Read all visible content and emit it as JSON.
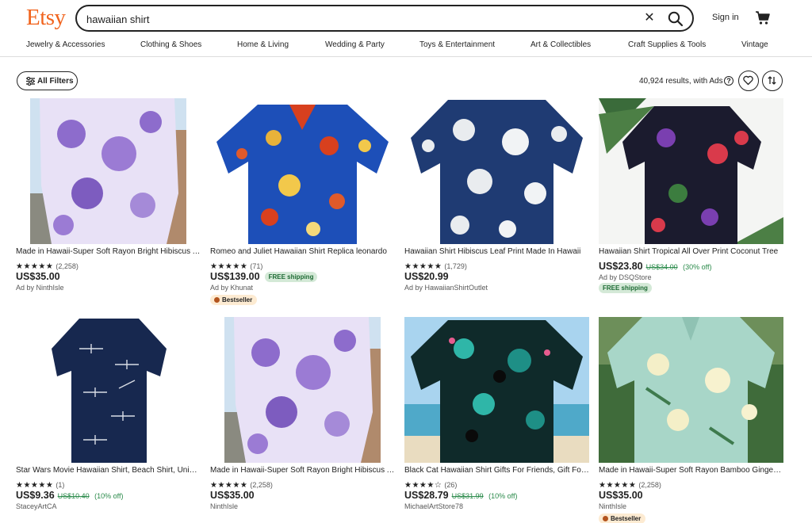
{
  "header": {
    "logo": "Etsy",
    "search_value": "hawaiian shirt",
    "signin": "Sign in"
  },
  "categories": [
    "Jewelry & Accessories",
    "Clothing & Shoes",
    "Home & Living",
    "Wedding & Party",
    "Toys & Entertainment",
    "Art & Collectibles",
    "Craft Supplies & Tools",
    "Vintage"
  ],
  "toolbar": {
    "filters_label": "All Filters",
    "results_text": "40,924 results, with Ads"
  },
  "listings": [
    {
      "title": "Made in Hawaii-Super Soft Rayon Bright Hibiscus Aloha Shirt",
      "stars": "★★★★★",
      "reviews": "(2,258)",
      "price": "US$35.00",
      "original": "",
      "discount": "",
      "shop": "Ad by NinthIsle",
      "free_shipping": "",
      "badge": ""
    },
    {
      "title": "Romeo and Juliet Hawaiian Shirt Replica leonardo",
      "stars": "★★★★★",
      "reviews": "(71)",
      "price": "US$139.00",
      "original": "",
      "discount": "",
      "shop": "Ad by Khunat",
      "free_shipping": "FREE shipping",
      "badge": "Bestseller"
    },
    {
      "title": "Hawaiian Shirt Hibiscus Leaf Print Made In Hawaii",
      "stars": "★★★★★",
      "reviews": "(1,729)",
      "price": "US$20.99",
      "original": "",
      "discount": "",
      "shop": "Ad by HawaiianShirtOutlet",
      "free_shipping": "",
      "badge": ""
    },
    {
      "title": "Hawaiian Shirt Tropical All Over Print Coconut Tree",
      "stars": "",
      "reviews": "",
      "price": "US$23.80",
      "original": "US$34.00",
      "discount": "(30% off)",
      "shop": "Ad by DSQStore",
      "free_shipping": "FREE shipping",
      "badge": ""
    },
    {
      "title": "Star Wars Movie Hawaiian Shirt, Beach Shirt, Unisex",
      "stars": "★★★★★",
      "reviews": "(1)",
      "price": "US$9.36",
      "original": "US$10.40",
      "discount": "(10% off)",
      "shop": "StaceyArtCA",
      "free_shipping": "",
      "badge": ""
    },
    {
      "title": "Made in Hawaii-Super Soft Rayon Bright Hibiscus Aloha Shirt",
      "stars": "★★★★★",
      "reviews": "(2,258)",
      "price": "US$35.00",
      "original": "",
      "discount": "",
      "shop": "NinthIsle",
      "free_shipping": "",
      "badge": ""
    },
    {
      "title": "Black Cat Hawaiian Shirt Gifts For Friends, Gift For Cat Lover",
      "stars": "★★★★☆",
      "reviews": "(26)",
      "price": "US$28.79",
      "original": "US$31.99",
      "discount": "(10% off)",
      "shop": "MichaelArtStore78",
      "free_shipping": "",
      "badge": ""
    },
    {
      "title": "Made in Hawaii-Super Soft Rayon Bamboo Ginger Aloha Shirt",
      "stars": "★★★★★",
      "reviews": "(2,258)",
      "price": "US$35.00",
      "original": "",
      "discount": "",
      "shop": "NinthIsle",
      "free_shipping": "",
      "badge": "Bestseller"
    }
  ],
  "icons": {
    "search": "search-icon",
    "clear": "close-icon",
    "cart": "cart-icon",
    "filters": "sliders-icon",
    "help": "question-circle-icon",
    "favorite": "heart-icon",
    "sort": "sort-arrows-icon"
  },
  "colors": {
    "brand": "#f1641e",
    "sale_green": "#2a8a4a",
    "shipping_bg": "#d4e9d7",
    "bestseller_bg": "#fdebd2"
  }
}
